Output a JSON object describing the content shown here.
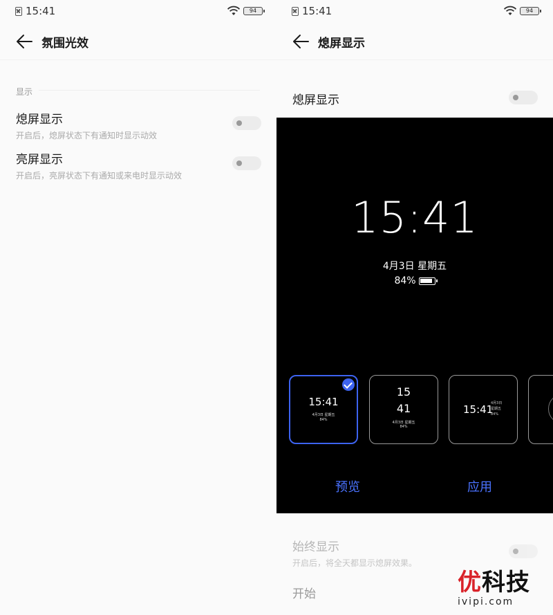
{
  "status_bar": {
    "time": "15:41",
    "battery": "94"
  },
  "left_screen": {
    "title": "氛围光效",
    "section_label": "显示",
    "settings": [
      {
        "title": "熄屏显示",
        "subtitle": "开启后，熄屏状态下有通知时显示动效",
        "enabled": false
      },
      {
        "title": "亮屏显示",
        "subtitle": "开启后，亮屏状态下有通知或来电时显示动效",
        "enabled": false
      }
    ]
  },
  "right_screen": {
    "title": "熄屏显示",
    "main_toggle": {
      "label": "熄屏显示",
      "enabled": false
    },
    "preview": {
      "clock": "15:41",
      "date": "4月3日 星期五",
      "battery_percent": "84%"
    },
    "styles": [
      {
        "type": "centered",
        "time": "15:41",
        "date": "4月3日 星期五",
        "battery": "84%",
        "selected": true
      },
      {
        "type": "stacked",
        "hour": "15",
        "minute": "41",
        "date": "4月3日 星期五",
        "battery": "84%",
        "selected": false
      },
      {
        "type": "side",
        "time": "15:41",
        "info_lines": [
          "4月3日",
          "星期五",
          "84%"
        ],
        "selected": false
      },
      {
        "type": "dial",
        "selected": false
      }
    ],
    "preview_button": "预览",
    "apply_button": "应用",
    "always_on": {
      "title": "始终显示",
      "subtitle": "开启后，将全天都显示熄屏效果。",
      "enabled": false
    },
    "start_label": "开始"
  },
  "watermark": {
    "brand_accent": "优",
    "brand_rest": "科技",
    "url": "ivipi.com"
  },
  "colors": {
    "accent_blue": "#3d63f0",
    "button_blue": "#4a72ff",
    "watermark_red": "#d9232a"
  }
}
